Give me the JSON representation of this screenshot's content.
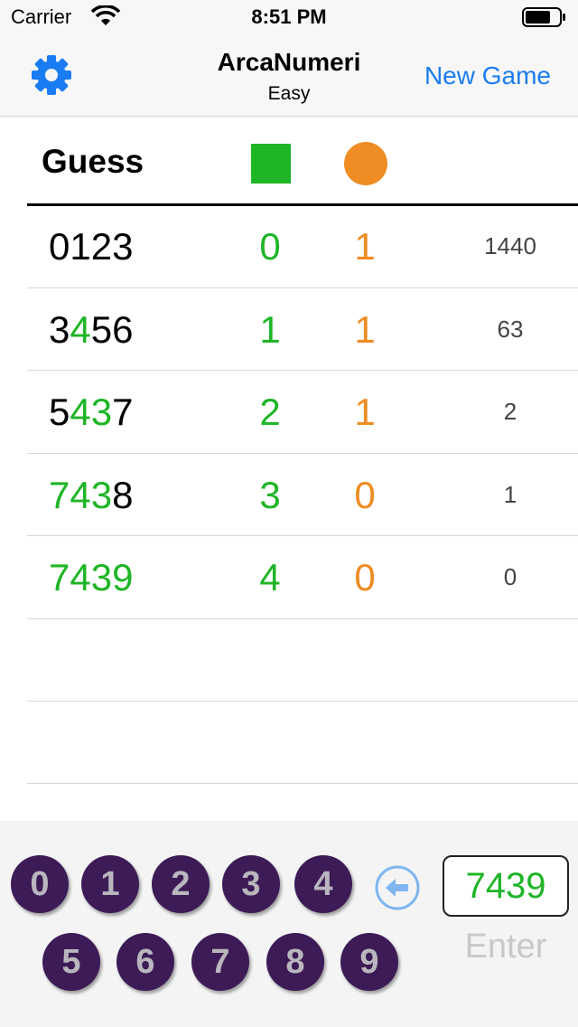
{
  "status_bar": {
    "carrier": "Carrier",
    "time": "8:51 PM"
  },
  "nav": {
    "title": "ArcaNumeri",
    "subtitle": "Easy",
    "new_game_label": "New Game",
    "settings_icon": "gear-icon"
  },
  "header": {
    "guess_label": "Guess",
    "bulls_marker": "green-square",
    "cows_marker": "orange-circle"
  },
  "colors": {
    "accent": "#1a7cf2",
    "correct": "#1fb526",
    "misplaced": "#ef8c23",
    "key": "#3d1b56"
  },
  "rows": [
    {
      "digits": [
        "0",
        "1",
        "2",
        "3"
      ],
      "green": [
        false,
        false,
        false,
        false
      ],
      "bulls": "0",
      "cows": "1",
      "remaining": "1440"
    },
    {
      "digits": [
        "3",
        "4",
        "5",
        "6"
      ],
      "green": [
        false,
        true,
        false,
        false
      ],
      "bulls": "1",
      "cows": "1",
      "remaining": "63"
    },
    {
      "digits": [
        "5",
        "4",
        "3",
        "7"
      ],
      "green": [
        false,
        true,
        true,
        false
      ],
      "bulls": "2",
      "cows": "1",
      "remaining": "2"
    },
    {
      "digits": [
        "7",
        "4",
        "3",
        "8"
      ],
      "green": [
        true,
        true,
        true,
        false
      ],
      "bulls": "3",
      "cows": "0",
      "remaining": "1"
    },
    {
      "digits": [
        "7",
        "4",
        "3",
        "9"
      ],
      "green": [
        true,
        true,
        true,
        true
      ],
      "bulls": "4",
      "cows": "0",
      "remaining": "0"
    }
  ],
  "keypad": {
    "keys": [
      "0",
      "1",
      "2",
      "3",
      "4",
      "5",
      "6",
      "7",
      "8",
      "9"
    ],
    "entry_value": "7439",
    "enter_label": "Enter",
    "backspace_icon": "backspace-arrow-icon"
  }
}
